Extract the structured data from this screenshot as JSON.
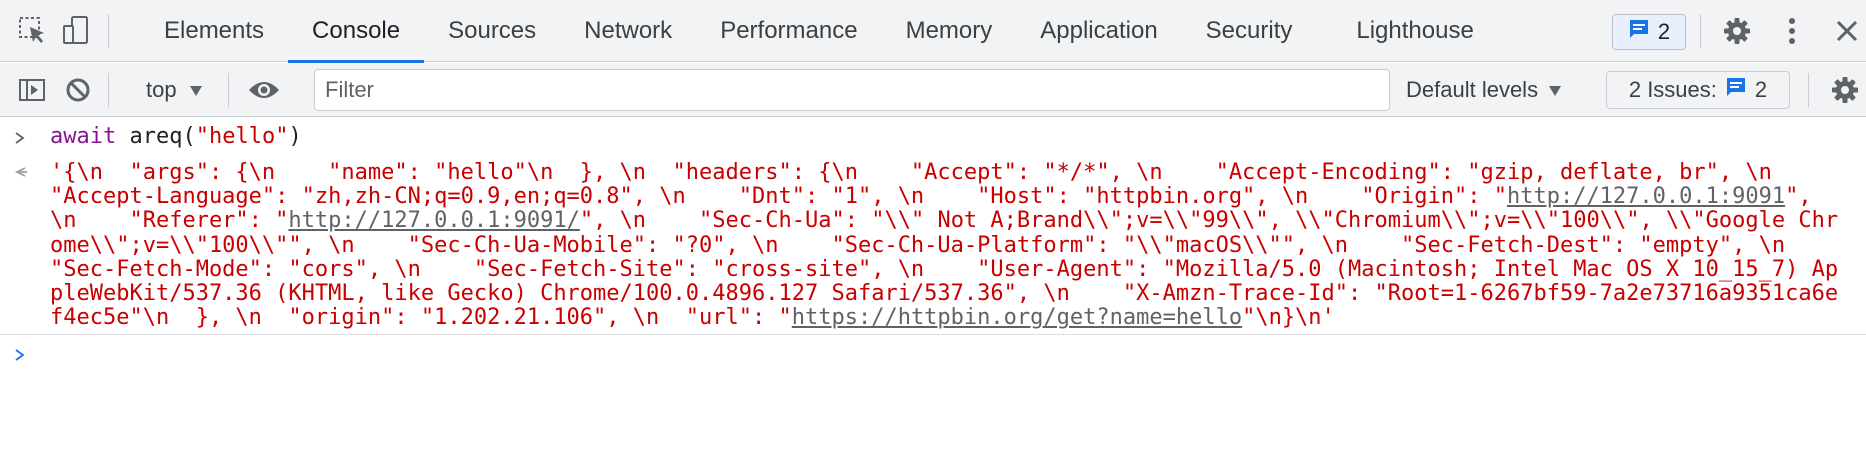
{
  "tabs": [
    "Elements",
    "Console",
    "Sources",
    "Network",
    "Performance",
    "Memory",
    "Application",
    "Security",
    "Lighthouse"
  ],
  "active_tab": "Console",
  "messages_badge_count": "2",
  "toolbar": {
    "context": "top",
    "filter_placeholder": "Filter",
    "levels_label": "Default levels",
    "issues_label": "2 Issues:",
    "issues_count": "2"
  },
  "console": {
    "command": {
      "keyword": "await",
      "call": "areq(",
      "arg": "\"hello\"",
      "close": ")"
    },
    "result": {
      "part1": "'{\\n  \"args\": {\\n    \"name\": \"hello\"\\n  }, \\n  \"headers\": {\\n    \"Accept\": \"*/*\", \\n    \"Accept-Encoding\": \"gzip, deflate, br\", \\n    \"Accept-Language\": \"zh,zh-CN;q=0.9,en;q=0.8\", \\n    \"Dnt\": \"1\", \\n    \"Host\": \"httpbin.org\", \\n    \"Origin\": \"",
      "link1": "http://127.0.0.1:9091",
      "part2": "\", \\n    \"Referer\": \"",
      "link2": "http://127.0.0.1:9091/",
      "part3": "\", \\n    \"Sec-Ch-Ua\": \"\\\\\" Not A;Brand\\\\\";v=\\\\\"99\\\\\", \\\\\"Chromium\\\\\";v=\\\\\"100\\\\\", \\\\\"Google Chrome\\\\\";v=\\\\\"100\\\\\"\", \\n    \"Sec-Ch-Ua-Mobile\": \"?0\", \\n    \"Sec-Ch-Ua-Platform\": \"\\\\\"macOS\\\\\"\", \\n    \"Sec-Fetch-Dest\": \"empty\", \\n    \"Sec-Fetch-Mode\": \"cors\", \\n    \"Sec-Fetch-Site\": \"cross-site\", \\n    \"User-Agent\": \"Mozilla/5.0 (Macintosh; Intel Mac OS X 10_15_7) AppleWebKit/537.36 (KHTML, like Gecko) Chrome/100.0.4896.127 Safari/537.36\", \\n    \"X-Amzn-Trace-Id\": \"Root=1-6267bf59-7a2e73716a9351ca6ef4ec5e\"\\n  }, \\n  \"origin\": \"1.202.21.106\", \\n  \"url\": \"",
      "link3": "https://httpbin.org/get?name=hello",
      "part4": "\"\\n}\\n'"
    }
  },
  "icons": [
    "inspect-element-icon",
    "device-toggle-icon",
    "settings-gear-icon",
    "more-vertical-icon",
    "close-icon",
    "sidebar-toggle-icon",
    "clear-console-icon",
    "dropdown-triangle-icon",
    "eye-icon",
    "message-icon"
  ],
  "colors": {
    "accent": "#1a73e8",
    "string_red": "#c80000",
    "keyword_purple": "#881391"
  }
}
